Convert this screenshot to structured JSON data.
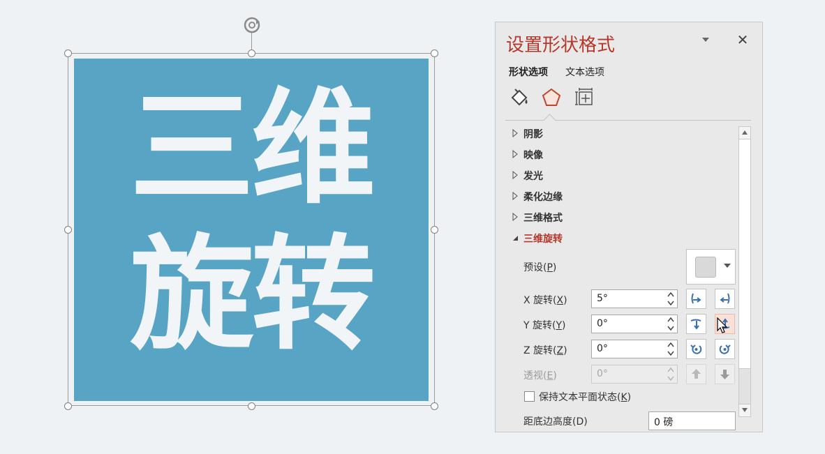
{
  "canvas": {
    "shape_text_line1": "三维",
    "shape_text_line2": "旋转",
    "shape_fill_color": "#57a4c5",
    "shape_text_color": "#f2f5f8"
  },
  "pane": {
    "title": "设置形状格式",
    "title_color": "#b5382a",
    "menu_icon": "chevron-down-icon",
    "close_glyph": "✕",
    "tabs": [
      {
        "label": "形状选项",
        "selected": true
      },
      {
        "label": "文本选项",
        "selected": false
      }
    ],
    "category_icons": [
      "fill-line-icon",
      "effects-pentagon-icon",
      "size-properties-icon"
    ],
    "sections": [
      {
        "label": "阴影",
        "expanded": false
      },
      {
        "label": "映像",
        "expanded": false
      },
      {
        "label": "发光",
        "expanded": false
      },
      {
        "label": "柔化边缘",
        "expanded": false
      },
      {
        "label": "三维格式",
        "expanded": false
      },
      {
        "label": "三维旋转",
        "expanded": true
      }
    ],
    "rotation": {
      "preset_label": "预设",
      "preset_key": "P",
      "x_label": "X 旋转",
      "x_key": "X",
      "x_value": "5°",
      "y_label": "Y 旋转",
      "y_key": "Y",
      "y_value": "0°",
      "z_label": "Z 旋转",
      "z_key": "Z",
      "z_value": "0°",
      "perspective_label": "透视",
      "perspective_key": "E",
      "perspective_value": "0°",
      "keep_flat_label": "保持文本平面状态",
      "keep_flat_key": "K",
      "keep_flat_checked": false,
      "depth_label_partial": "距底边高度(D)",
      "depth_value_partial": "0 磅"
    }
  }
}
